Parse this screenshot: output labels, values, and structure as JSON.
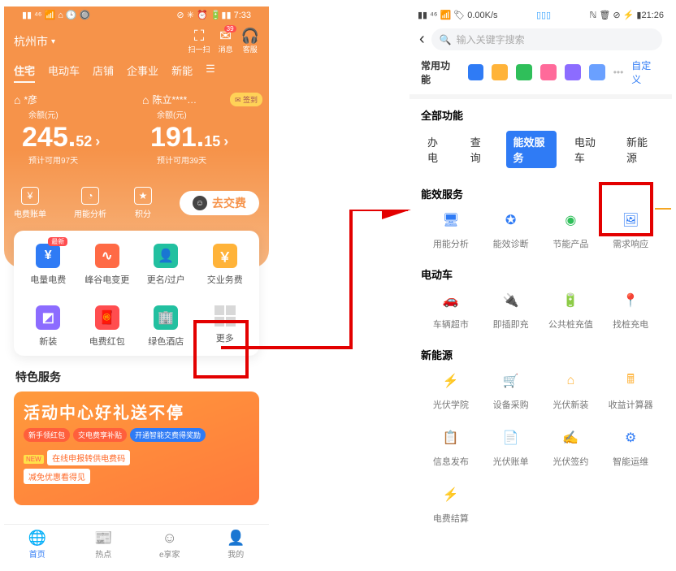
{
  "left_status": {
    "carrier": "▮▮ ⁴⁶ 📶 ⌂ 🕒 🔘",
    "right": "⊘ ✳ ⏰ 🔋▮▮ 7:33"
  },
  "right_status": {
    "l": "▮▮ ⁴⁶ 📶 🏷 0.00K/s",
    "mid": "▯▯▯",
    "r": "ℕ 🗑 ⊘ ⚡ ▮21:26"
  },
  "city": "杭州市",
  "hero_icons": {
    "scan": "扫一扫",
    "msg": "消息",
    "msg_badge": "39",
    "cs": "客服"
  },
  "hero_tabs": [
    "住宅",
    "电动车",
    "店铺",
    "企事业",
    "新能"
  ],
  "card1": {
    "owner": "*彦",
    "label": "余额(元)",
    "int": "245.",
    "dec": "52",
    "days": "预计可用97天"
  },
  "card2": {
    "owner": "陈立****…",
    "label": "余额(元)",
    "int": "191.",
    "dec": "15",
    "days": "预计可用39天",
    "sign": "✉ 签到"
  },
  "mini": {
    "bill": "电费账单",
    "use": "用能分析",
    "points": "积分"
  },
  "pay_btn": "去交费",
  "grid_items": [
    {
      "name": "电量电费",
      "color": "#2f7bf5",
      "glyph": "¥",
      "tag": "最新"
    },
    {
      "name": "峰谷电变更",
      "color": "#ff6a45",
      "glyph": "∿"
    },
    {
      "name": "更名/过户",
      "color": "#22c0a0",
      "glyph": "👤"
    },
    {
      "name": "交业务费",
      "color": "#ffb339",
      "glyph": "￥"
    },
    {
      "name": "新装",
      "color": "#8c6cff",
      "glyph": "◩"
    },
    {
      "name": "电费红包",
      "color": "#ff4d4f",
      "glyph": "🧧"
    },
    {
      "name": "绿色酒店",
      "color": "#22c0a0",
      "glyph": "🏢"
    },
    {
      "name": "更多",
      "more": true
    }
  ],
  "special": "特色服务",
  "promo": {
    "title": "活动中心好礼送不停",
    "pill1": "新手领红包",
    "pill2": "交电费享补贴",
    "pill3": "开通智能交费得奖励",
    "new": "NEW",
    "line1": "在线申报转供电费码",
    "line2": "减免优惠看得见"
  },
  "bottom": [
    {
      "l": "首页"
    },
    {
      "l": "热点"
    },
    {
      "l": "e享家"
    },
    {
      "l": "我的"
    }
  ],
  "search_ph": "输入关键字搜索",
  "fav_label": "常用功能",
  "fav_custom": "自定义",
  "all_label": "全部功能",
  "cat_tabs": [
    "办电",
    "查询",
    "能效服务",
    "电动车",
    "新能源"
  ],
  "sec1": {
    "t": "能效服务",
    "items": [
      {
        "n": "用能分析",
        "c": "#2f7bf5",
        "g": "🖥"
      },
      {
        "n": "能效诊断",
        "c": "#2f7bf5",
        "g": "✪"
      },
      {
        "n": "节能产品",
        "c": "#2fbf5a",
        "g": "◉"
      },
      {
        "n": "需求响应",
        "c": "#2f7bf5",
        "g": "🖼"
      }
    ]
  },
  "sec2": {
    "t": "电动车",
    "items": [
      {
        "n": "车辆超市",
        "c": "#8c6cff",
        "g": "🚗"
      },
      {
        "n": "即插即充",
        "c": "#2fbf5a",
        "g": "🔌"
      },
      {
        "n": "公共桩充值",
        "c": "#2f7bf5",
        "g": "🔋"
      },
      {
        "n": "找桩充电",
        "c": "#2fbf5a",
        "g": "📍"
      }
    ]
  },
  "sec3": {
    "t": "新能源",
    "items": [
      {
        "n": "光伏学院",
        "c": "#2f7bf5",
        "g": "⚡"
      },
      {
        "n": "设备采购",
        "c": "#2f7bf5",
        "g": "🛒"
      },
      {
        "n": "光伏新装",
        "c": "#ffb339",
        "g": "⌂"
      },
      {
        "n": "收益计算器",
        "c": "#ffb339",
        "g": "🖩"
      },
      {
        "n": "信息发布",
        "c": "#2f7bf5",
        "g": "📋"
      },
      {
        "n": "光伏账单",
        "c": "#2f7bf5",
        "g": "📄"
      },
      {
        "n": "光伏签约",
        "c": "#2f7bf5",
        "g": "✍"
      },
      {
        "n": "智能运维",
        "c": "#2f7bf5",
        "g": "⚙"
      },
      {
        "n": "电费结算",
        "c": "#2fbf5a",
        "g": "⚡"
      }
    ]
  }
}
